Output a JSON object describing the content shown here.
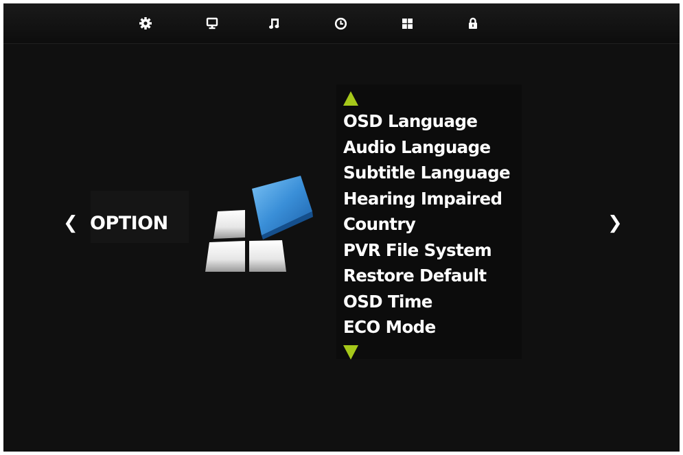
{
  "top_tabs": [
    {
      "name": "gear-icon"
    },
    {
      "name": "monitor-icon"
    },
    {
      "name": "music-note-icon"
    },
    {
      "name": "clock-icon"
    },
    {
      "name": "grid-icon"
    },
    {
      "name": "lock-icon"
    }
  ],
  "category": {
    "label": "OPTION",
    "prev_icon": "chevron-left-icon",
    "next_icon": "chevron-right-icon",
    "prev_glyph": "❮",
    "next_glyph": "❯"
  },
  "menu": {
    "items": [
      "OSD Language",
      "Audio Language",
      "Subtitle Language",
      "Hearing Impaired",
      "Country",
      "PVR File System",
      "Restore Default",
      "OSD Time",
      "ECO Mode"
    ]
  },
  "colors": {
    "background": "#101010",
    "text": "#ffffff",
    "scroll_arrow": "#a6c81a",
    "accent_tile": "#3a8fd8"
  }
}
